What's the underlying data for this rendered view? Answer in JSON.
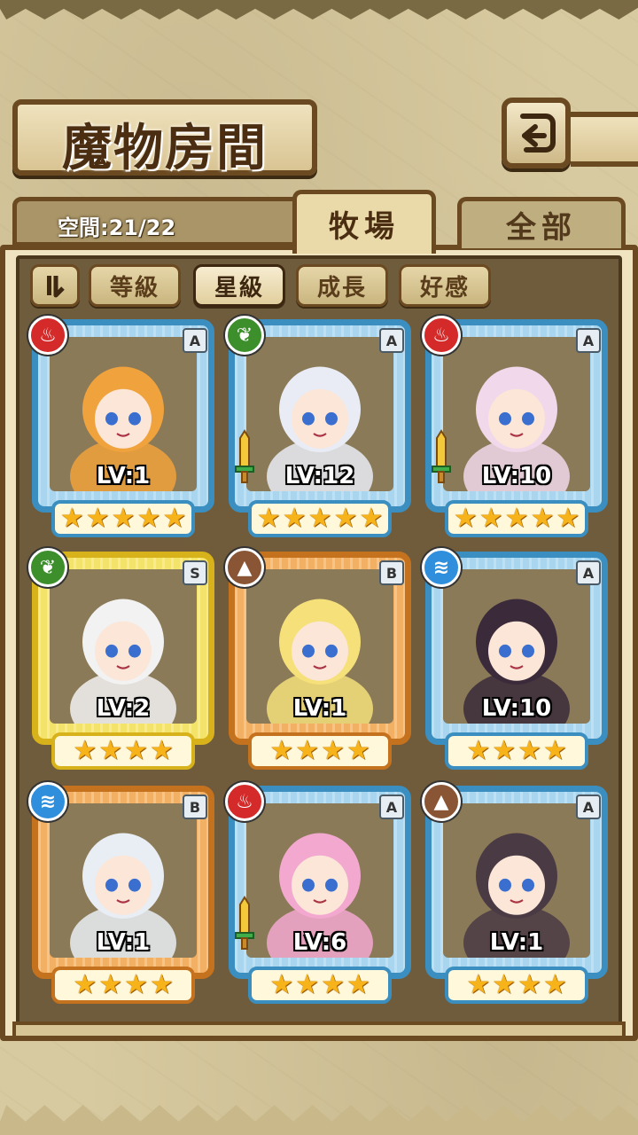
{
  "header": {
    "title": "魔物房間",
    "back_label": "⮌"
  },
  "capacity": {
    "label": "空間:21/22"
  },
  "tabs": [
    {
      "label": "牧場",
      "active": true
    },
    {
      "label": "全部",
      "active": false
    }
  ],
  "sort": {
    "toggle_icon": "sort-order-icon",
    "buttons": [
      {
        "label": "等級",
        "selected": false
      },
      {
        "label": "星級",
        "selected": true
      },
      {
        "label": "成長",
        "selected": false
      },
      {
        "label": "好感",
        "selected": false
      }
    ]
  },
  "cards": [
    {
      "level": "LV:1",
      "rank": "A",
      "element": "fire-icon",
      "element_glyph": "♨",
      "frame": "blue",
      "stars": 5,
      "sword": false,
      "color": "#f0a23c"
    },
    {
      "level": "LV:12",
      "rank": "A",
      "element": "leaf-icon",
      "element_glyph": "❦",
      "frame": "blue",
      "stars": 5,
      "sword": true,
      "color": "#e9ecf5"
    },
    {
      "level": "LV:10",
      "rank": "A",
      "element": "fire-icon",
      "element_glyph": "♨",
      "frame": "blue",
      "stars": 5,
      "sword": true,
      "color": "#f1d8ea"
    },
    {
      "level": "LV:2",
      "rank": "S",
      "element": "leaf-icon",
      "element_glyph": "❦",
      "frame": "gold",
      "stars": 4,
      "sword": false,
      "color": "#f2f2f2"
    },
    {
      "level": "LV:1",
      "rank": "B",
      "element": "earth-icon",
      "element_glyph": "▲",
      "frame": "orange",
      "stars": 4,
      "sword": false,
      "color": "#f5e07a"
    },
    {
      "level": "LV:10",
      "rank": "A",
      "element": "water-icon",
      "element_glyph": "≋",
      "frame": "blue",
      "stars": 4,
      "sword": false,
      "color": "#3a2a3a"
    },
    {
      "level": "LV:1",
      "rank": "B",
      "element": "water-icon",
      "element_glyph": "≋",
      "frame": "orange",
      "stars": 4,
      "sword": false,
      "color": "#e9eef4"
    },
    {
      "level": "LV:6",
      "rank": "A",
      "element": "fire-icon",
      "element_glyph": "♨",
      "frame": "blue",
      "stars": 4,
      "sword": true,
      "color": "#f3a8cf"
    },
    {
      "level": "LV:1",
      "rank": "A",
      "element": "earth-icon",
      "element_glyph": "▲",
      "frame": "blue",
      "stars": 4,
      "sword": false,
      "color": "#4a3a44"
    }
  ],
  "colors": {
    "frame_blue": "#3b8fc0",
    "frame_gold": "#d7b21a",
    "frame_orange": "#c5721f",
    "star": "#f6b31a",
    "panel_brown": "#6b4a22"
  }
}
